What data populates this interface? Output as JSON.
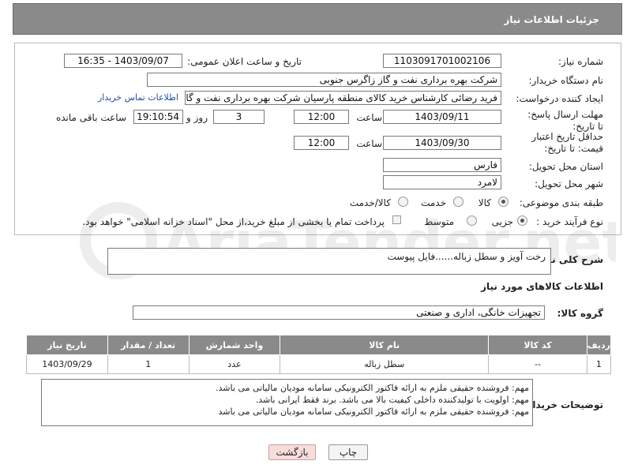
{
  "header": {
    "title": "جزئیات اطلاعات نیاز"
  },
  "form": {
    "need_number_label": "شماره نیاز:",
    "need_number": "1103091701002106",
    "announce_label": "تاریخ و ساعت اعلان عمومی:",
    "announce_value": "1403/09/07 - 16:35",
    "buyer_org_label": "نام دستگاه خریدار:",
    "buyer_org": "شرکت بهره برداری نفت و گاز زاگرس جنوبی",
    "creator_label": "ایجاد کننده درخواست:",
    "creator": "فرید رضائی کارشناس خرید کالای منطقه پارسیان شرکت بهره برداری نفت و گاز",
    "contact_link": "اطلاعات تماس خریدار",
    "reply_deadline_label": "مهلت ارسال پاسخ: تا تاریخ:",
    "reply_date": "1403/09/11",
    "time_label": "ساعت",
    "reply_time": "12:00",
    "days_value": "3",
    "days_label": "روز و",
    "remaining_time": "19:10:54",
    "remaining_label": "ساعت باقی مانده",
    "validity_label": "حداقل تاریخ اعتبار قیمت: تا تاریخ:",
    "validity_date": "1403/09/30",
    "validity_time": "12:00",
    "province_label": "استان محل تحویل:",
    "province": "فارس",
    "city_label": "شهر محل تحویل:",
    "city": "لامرد",
    "category_label": "طبقه بندی موضوعی:",
    "category_options": [
      "کالا",
      "خدمت",
      "کالا/خدمت"
    ],
    "category_selected": 0,
    "purchase_type_label": "نوع فرآیند خرید :",
    "purchase_options": [
      "جزیی",
      "متوسط"
    ],
    "purchase_selected": 0,
    "payment_note": "پرداخت تمام یا بخشی از مبلغ خرید،از محل \"اسناد خزانه اسلامی\" خواهد بود."
  },
  "summary": {
    "label": "شرح کلی نیاز:",
    "value": "رخت آویز و سطل زباله......فایل پیوست"
  },
  "goods_info_title": "اطلاعات کالاهای مورد نیاز",
  "goods_group": {
    "label": "گروه کالا:",
    "value": "تجهیزات خانگی، اداری و صنعتی"
  },
  "table": {
    "headers": [
      "ردیف",
      "کد کالا",
      "نام کالا",
      "واحد شمارش",
      "تعداد / مقدار",
      "تاریخ نیاز"
    ],
    "rows": [
      [
        "1",
        "--",
        "سطل زباله",
        "عدد",
        "1",
        "1403/09/29"
      ]
    ]
  },
  "buyer_notes": {
    "label": "توضیحات خریدار:",
    "lines": [
      "مهم: فروشنده حقیقی ملزم به ارائه فاکتور الکترونیکی سامانه مودیان مالیاتی می باشد.",
      "مهم: اولویت با تولیدکننده داخلی کیفیت بالا می باشد. برند فقط ایرانی باشد.",
      "مهم: فروشنده حقیقی ملزم به ارائه فاکتور الکترونیکی سامانه مودیان مالیاتی می باشد"
    ]
  },
  "buttons": {
    "print": "چاپ",
    "back": "بازگشت"
  },
  "watermark": "AriaTender.net",
  "colors": {
    "header_bg": "#8a8a8a",
    "link": "#1a4fb5",
    "back_btn_bg": "#f8dcdc"
  }
}
